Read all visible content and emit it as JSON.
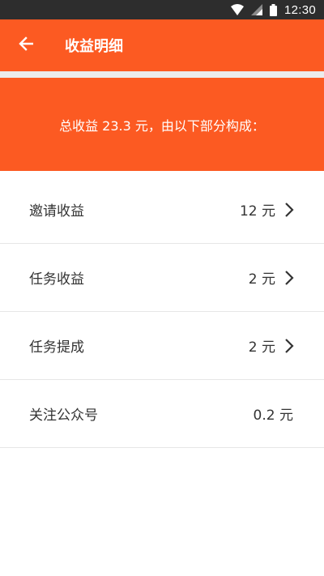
{
  "status_bar": {
    "time": "12:30",
    "icons": [
      "wifi-icon",
      "cellular-signal-icon",
      "battery-icon"
    ]
  },
  "app_bar": {
    "back_icon": "arrow-left-icon",
    "title": "收益明细"
  },
  "summary": {
    "text": "总收益 23.3 元，由以下部分构成："
  },
  "items": [
    {
      "label": "邀请收益",
      "value": "12 元",
      "has_chevron": true
    },
    {
      "label": "任务收益",
      "value": "2 元",
      "has_chevron": true
    },
    {
      "label": "任务提成",
      "value": "2 元",
      "has_chevron": true
    },
    {
      "label": "关注公众号",
      "value": "0.2 元",
      "has_chevron": false
    }
  ],
  "colors": {
    "accent": "#fc5a22",
    "status_bar": "#2d2d2d",
    "divider": "#e6e6e6",
    "text": "#333333"
  }
}
